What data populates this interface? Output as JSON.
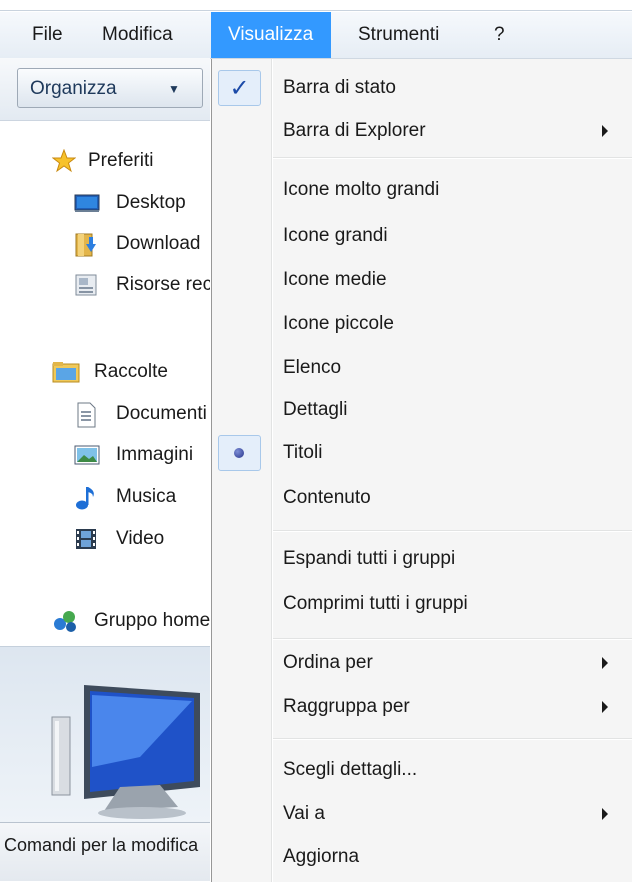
{
  "menubar": {
    "items": [
      {
        "label": "File"
      },
      {
        "label": "Modifica"
      },
      {
        "label": "Visualizza"
      },
      {
        "label": "Strumenti"
      },
      {
        "label": "?"
      }
    ],
    "active_color": "#3399ff"
  },
  "toolbar": {
    "organize_label": "Organizza"
  },
  "nav": {
    "favorites": {
      "header": "Preferiti",
      "items": [
        {
          "label": "Desktop",
          "icon": "desktop-icon"
        },
        {
          "label": "Download",
          "icon": "downloads-icon"
        },
        {
          "label": "Risorse recenti",
          "icon": "recent-places-icon"
        }
      ]
    },
    "libraries": {
      "header": "Raccolte",
      "items": [
        {
          "label": "Documenti",
          "icon": "documents-icon"
        },
        {
          "label": "Immagini",
          "icon": "pictures-icon"
        },
        {
          "label": "Musica",
          "icon": "music-icon"
        },
        {
          "label": "Video",
          "icon": "video-icon"
        }
      ]
    },
    "homegroup": {
      "label": "Gruppo home"
    }
  },
  "status": {
    "text": "Comandi per la modifica"
  },
  "view_menu": {
    "items": [
      {
        "label": "Barra di stato",
        "checked": true
      },
      {
        "label": "Barra di Explorer",
        "submenu": true
      },
      {
        "label": "Icone molto grandi"
      },
      {
        "label": "Icone grandi"
      },
      {
        "label": "Icone medie"
      },
      {
        "label": "Icone piccole"
      },
      {
        "label": "Elenco"
      },
      {
        "label": "Dettagli"
      },
      {
        "label": "Titoli",
        "selected": true
      },
      {
        "label": "Contenuto"
      },
      {
        "label": "Espandi tutti i gruppi"
      },
      {
        "label": "Comprimi tutti i gruppi"
      },
      {
        "label": "Ordina per",
        "submenu": true
      },
      {
        "label": "Raggruppa per",
        "submenu": true
      },
      {
        "label": "Scegli dettagli..."
      },
      {
        "label": "Vai a",
        "submenu": true
      },
      {
        "label": "Aggiorna"
      }
    ]
  }
}
